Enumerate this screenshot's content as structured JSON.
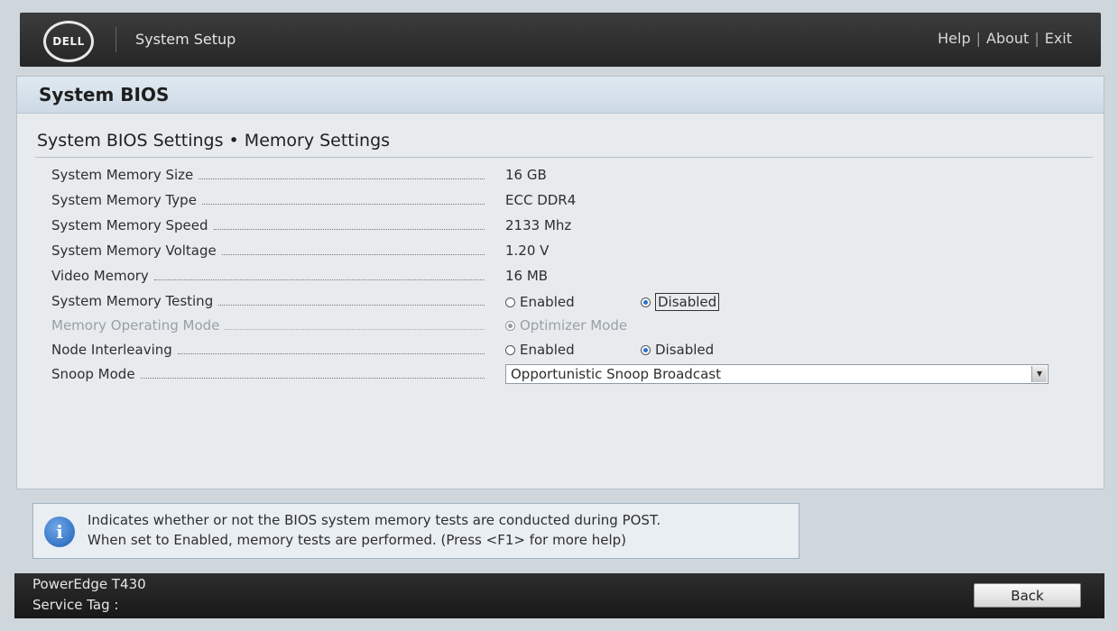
{
  "header": {
    "logo_text": "DELL",
    "app_title": "System Setup",
    "links": {
      "help": "Help",
      "about": "About",
      "exit": "Exit",
      "separator": "|"
    }
  },
  "panel": {
    "title": "System BIOS",
    "subtitle": "System BIOS Settings • Memory Settings"
  },
  "settings": {
    "memory_size": {
      "label": "System Memory Size",
      "value": "16 GB"
    },
    "memory_type": {
      "label": "System Memory Type",
      "value": "ECC DDR4"
    },
    "memory_speed": {
      "label": "System Memory Speed",
      "value": "2133 Mhz"
    },
    "memory_voltage": {
      "label": "System Memory Voltage",
      "value": "1.20 V"
    },
    "video_memory": {
      "label": "Video Memory",
      "value": "16 MB"
    },
    "memory_testing": {
      "label": "System Memory Testing",
      "option_enabled": "Enabled",
      "option_disabled": "Disabled",
      "selected": "Disabled"
    },
    "operating_mode": {
      "label": "Memory Operating Mode",
      "option": "Optimizer Mode",
      "state": "disabled"
    },
    "node_interleaving": {
      "label": "Node Interleaving",
      "option_enabled": "Enabled",
      "option_disabled": "Disabled",
      "selected": "Disabled"
    },
    "snoop_mode": {
      "label": "Snoop Mode",
      "value": "Opportunistic Snoop Broadcast"
    }
  },
  "help": {
    "icon": "info-icon",
    "line1": "Indicates whether or not the BIOS system memory tests are conducted during POST.",
    "line2": "When set to Enabled, memory tests are performed. (Press <F1> for more help)"
  },
  "footer": {
    "model": "PowerEdge T430",
    "service_tag": "Service Tag :",
    "back_label": "Back"
  },
  "colors": {
    "accent": "#2a6fd6",
    "header_bg": "#262626",
    "panel_bg": "#e7ebee"
  }
}
